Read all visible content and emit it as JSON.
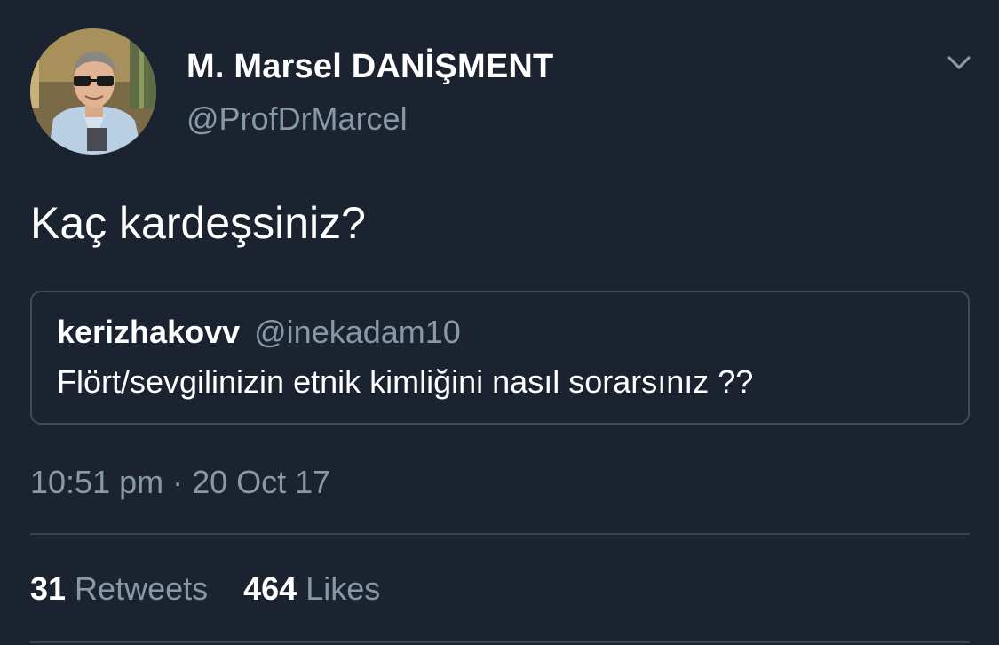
{
  "author": {
    "name": "M. Marsel DANİŞMENT",
    "handle": "@ProfDrMarcel"
  },
  "tweet": {
    "text": "Kaç kardeşsiniz?",
    "timestamp": "10:51 pm · 20 Oct 17"
  },
  "quoted_tweet": {
    "name": "kerizhakovv",
    "handle": "@inekadam10",
    "text": "Flört/sevgilinizin etnik kimliğini nasıl sorarsınız ??"
  },
  "stats": {
    "retweets_count": "31",
    "retweets_label": "Retweets",
    "likes_count": "464",
    "likes_label": "Likes"
  },
  "icons": {
    "menu": "chevron-down-icon",
    "avatar": "profile-photo"
  },
  "colors": {
    "background": "#1b2230",
    "primary_text": "#ffffff",
    "secondary_text": "#8899a6",
    "border": "#3d4a5a"
  }
}
